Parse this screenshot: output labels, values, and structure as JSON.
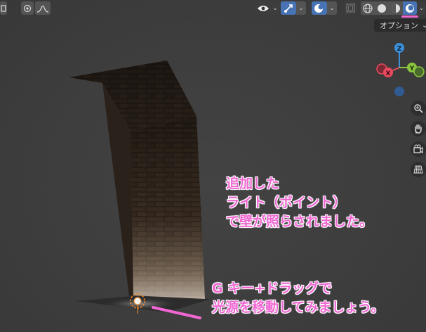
{
  "header": {
    "dropdown_label": "オプション",
    "dropdown_arrow": "⌄",
    "left_icons": [
      "view-icon",
      "pivot-icon",
      "falloff-icon"
    ],
    "right_icons": [
      "visibility-icon",
      "gizmo-icon",
      "overlay-icon",
      "xray-icon",
      "wireframe-shading-icon",
      "solid-shading-icon",
      "material-shading-icon",
      "rendered-shading-icon"
    ]
  },
  "gizmo": {
    "z_label": "Z",
    "y_label": "Y",
    "x_label": "X"
  },
  "nav_buttons": [
    "zoom-icon",
    "hand-pan-icon",
    "camera-icon",
    "grid-icon"
  ],
  "annotations": {
    "block1": [
      "追加した",
      "ライト（ポイント）",
      "で壁が照らされました。"
    ],
    "block2": [
      "G キー+ドラッグで",
      "光源を移動してみましょう。"
    ]
  },
  "colors": {
    "annotation_text": "#f067d3",
    "annotation_outline": "#ffffff",
    "axis_x": "#e84a5f",
    "axis_y": "#8cc63f",
    "axis_z": "#3c8fd8",
    "active_button": "#4772b3",
    "highlight_underline": "#f067d3"
  }
}
